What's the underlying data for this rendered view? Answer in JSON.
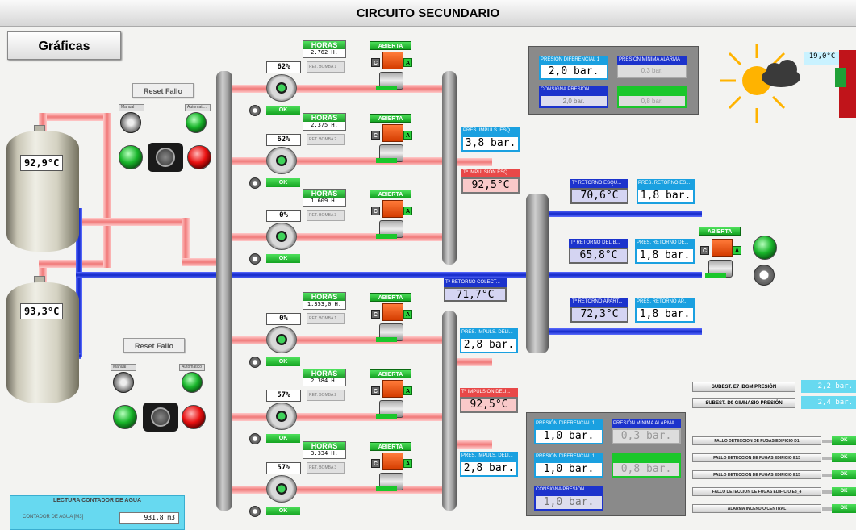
{
  "header": {
    "title": "CIRCUITO SECUNDARIO"
  },
  "graficas_label": "Gráficas",
  "tanks": [
    {
      "temp": "92,9°C"
    },
    {
      "temp": "93,3°C"
    }
  ],
  "control_groups": [
    {
      "reset_label": "Reset Fallo",
      "manual_label": "Manual",
      "auto_label": "Automati..."
    },
    {
      "reset_label": "Reset Fallo",
      "manual_label": "Manual",
      "auto_label": "Automatico"
    }
  ],
  "pumps": [
    {
      "horas_label": "HORAS",
      "horas": "2.762 H.",
      "pct": "62%",
      "ret_label": "RET. BOMBA 1",
      "ok": "OK",
      "valve": "ABIERTA"
    },
    {
      "horas_label": "HORAS",
      "horas": "2.375 H.",
      "pct": "62%",
      "ret_label": "RET. BOMBA 2",
      "ok": "OK",
      "valve": "ABIERTA"
    },
    {
      "horas_label": "HORAS",
      "horas": "1.609 H.",
      "pct": "0%",
      "ret_label": "RET. BOMBA 3",
      "ok": "OK",
      "valve": "ABIERTA"
    },
    {
      "horas_label": "HORAS",
      "horas": "1.353,0 H.",
      "pct": "0%",
      "ret_label": "RET. BOMBA 1",
      "ok": "OK",
      "valve": "ABIERTA"
    },
    {
      "horas_label": "HORAS",
      "horas": "2.384 H.",
      "pct": "57%",
      "ret_label": "RET. BOMBA 2",
      "ok": "OK",
      "valve": "ABIERTA"
    },
    {
      "horas_label": "HORAS",
      "horas": "3.334 H.",
      "pct": "57%",
      "ret_label": "RET. BOMBA 3",
      "ok": "OK",
      "valve": "ABIERTA"
    }
  ],
  "valve_buttons": {
    "c": "C",
    "a": "A"
  },
  "impulsion": {
    "esq_pres_label": "PRES. IMPULS. ESQ...",
    "esq_pres": "3,8 bar.",
    "esq_temp_label": "Tª IMPULSION ESQ...",
    "esq_temp": "92,5°C",
    "deli_pres_label": "PRES. IMPULS. DELI...",
    "deli_pres": "2,8 bar.",
    "deli_temp_label": "Tª IMPULSION DELI...",
    "deli_temp": "92,5°C",
    "deli2_pres_label": "PRES. IMPULS. DELI...",
    "deli2_pres": "2,8 bar."
  },
  "colector": {
    "label": "Tª RETORNO COLECT...",
    "value": "71,7°C"
  },
  "retornos": [
    {
      "t_label": "Tª RETORNO ESQU...",
      "t": "70,6°C",
      "p_label": "PRES. RETORNO ES...",
      "p": "1,8 bar."
    },
    {
      "t_label": "Tª RETORNO DELIB...",
      "t": "65,8°C",
      "p_label": "PRES. RETORNO DE...",
      "p": "1,8 bar."
    },
    {
      "t_label": "Tª RETORNO APART...",
      "t": "72,3°C",
      "p_label": "PRES. RETORNO AP...",
      "p": "1,8 bar."
    }
  ],
  "return_valve": "ABIERTA",
  "outdoor_temp": "19,0°C",
  "top_panel": {
    "dif_label": "PRESIÓN DIFERENCIAL 1",
    "dif": "2,0 bar.",
    "min_label": "PRESIÓN MÍNIMA ALARMA",
    "min": "0,3 bar.",
    "cons_label": "CONSIGNA PRESIÓN",
    "cons": "2,0 bar.",
    "other": "0,8 bar."
  },
  "bottom_panel": {
    "dif1_label": "PRESIÓN DIFERENCIAL 1",
    "dif1": "1,0 bar.",
    "min_label": "PRESIÓN MÍNIMA ALARMA",
    "min": "0,3 bar.",
    "dif2_label": "PRESIÓN DIFERENCIAL 1",
    "dif2": "1,0 bar.",
    "other": "0,8 bar.",
    "cons_label": "CONSIGNA PRESIÓN",
    "cons": "1,0 bar."
  },
  "subest": [
    {
      "label": "SUBEST. E7 IBGM PRESIÓN",
      "value": "2,2 bar."
    },
    {
      "label": "SUBEST. D9 GIMNASIO PRESIÓN",
      "value": "2,4 bar."
    }
  ],
  "fallos": [
    {
      "label": "FALLO DETECCION DE FUGAS EDIFICIO D1",
      "status": "OK"
    },
    {
      "label": "FALLO DETECCION DE FUGAS EDIFICIO E13",
      "status": "OK"
    },
    {
      "label": "FALLO DETECCION DE FUGAS EDIFICIO E15",
      "status": "OK"
    },
    {
      "label": "FALLO DETECCION DE FUGAS EDIFICIO E8_4",
      "status": "OK"
    },
    {
      "label": "ALARMA INCENDIO CENTRAL",
      "status": "OK"
    }
  ],
  "water_meter": {
    "title": "LECTURA CONTADOR DE AGUA",
    "label": "CONTADOR DE AGUA [M3]",
    "value": "931,8 m3"
  },
  "colors": {
    "hot_pipe": "#f07979",
    "cold_pipe": "#1228c8",
    "ok_green": "#14a321",
    "accent_cyan": "#1aa0e0"
  }
}
